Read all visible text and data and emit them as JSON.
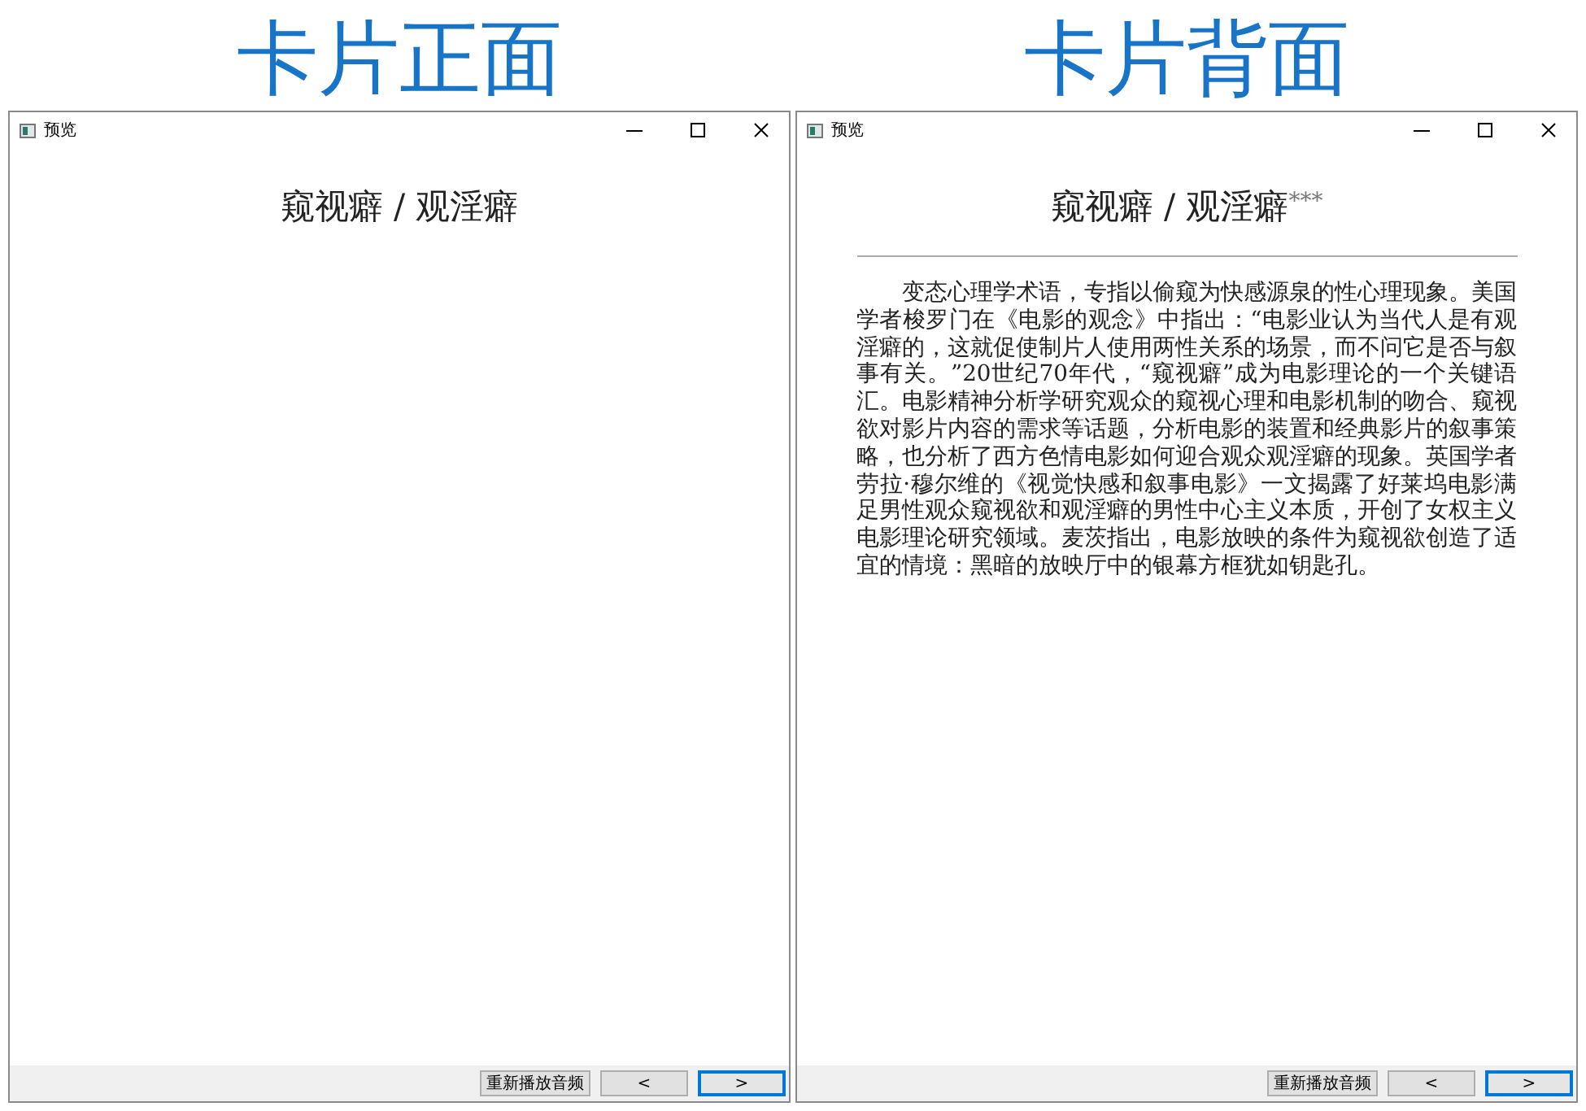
{
  "panels": [
    {
      "heading": "卡片正面",
      "window": {
        "title": "预览",
        "card_title": "窥视癖 / 观淫癖",
        "rule": false,
        "buttons": [
          {
            "label": "重新播放音频",
            "focused": false
          },
          {
            "label": "<",
            "focused": false
          },
          {
            "label": ">",
            "focused": true
          }
        ]
      }
    },
    {
      "heading": "卡片背面",
      "window": {
        "title": "预览",
        "card_title": "窥视癖 / 观淫癖$^{***}$",
        "rule": true,
        "body": "变态心理学术语，专指以偷窥为快感源泉的性心理现象。美国学者梭罗门在《电影的观念》中指出：“电影业认为当代人是有观淫癖的，这就促使制片人使用两性关系的场景，而不问它是否与叙事有关。”20世纪70年代，“窥视癖”成为电影理论的一个关键语汇。电影精神分析学研究观众的窥视心理和电影机制的吻合、窥视欲对影片内容的需求等话题，分析电影的装置和经典影片的叙事策略，也分析了西方色情电影如何迎合观众观淫癖的现象。英国学者劳拉·穆尔维的《视觉快感和叙事电影》一文揭露了好莱坞电影满足男性观众窥视欲和观淫癖的男性中心主义本质，开创了女权主义电影理论研究领域。麦茨指出，电影放映的条件为窥视欲创造了适宜的情境：黑暗的放映厅中的银幕方框犹如钥匙孔。",
        "buttons": [
          {
            "label": "重新播放音频",
            "focused": false
          },
          {
            "label": "<",
            "focused": false
          },
          {
            "label": ">",
            "focused": true
          }
        ]
      }
    }
  ]
}
